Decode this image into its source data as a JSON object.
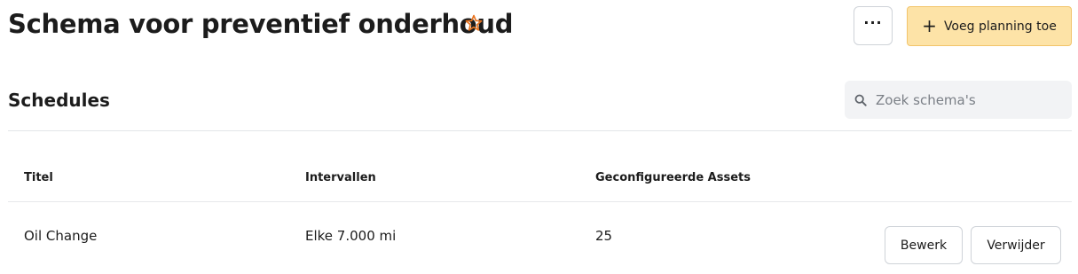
{
  "header": {
    "title": "Schema voor preventief onderhoud",
    "more_label": "···",
    "add_button_label": "Voeg planning toe",
    "accent_color": "#e8731f"
  },
  "section": {
    "title": "Schedules",
    "search_placeholder": "Zoek schema's"
  },
  "table": {
    "columns": [
      "Titel",
      "Intervallen",
      "Geconfigureerde Assets"
    ],
    "rows": [
      {
        "title": "Oil Change",
        "intervals": "Elke 7.000 mi",
        "assets": "25",
        "edit_label": "Bewerk",
        "delete_label": "Verwijder"
      }
    ]
  }
}
